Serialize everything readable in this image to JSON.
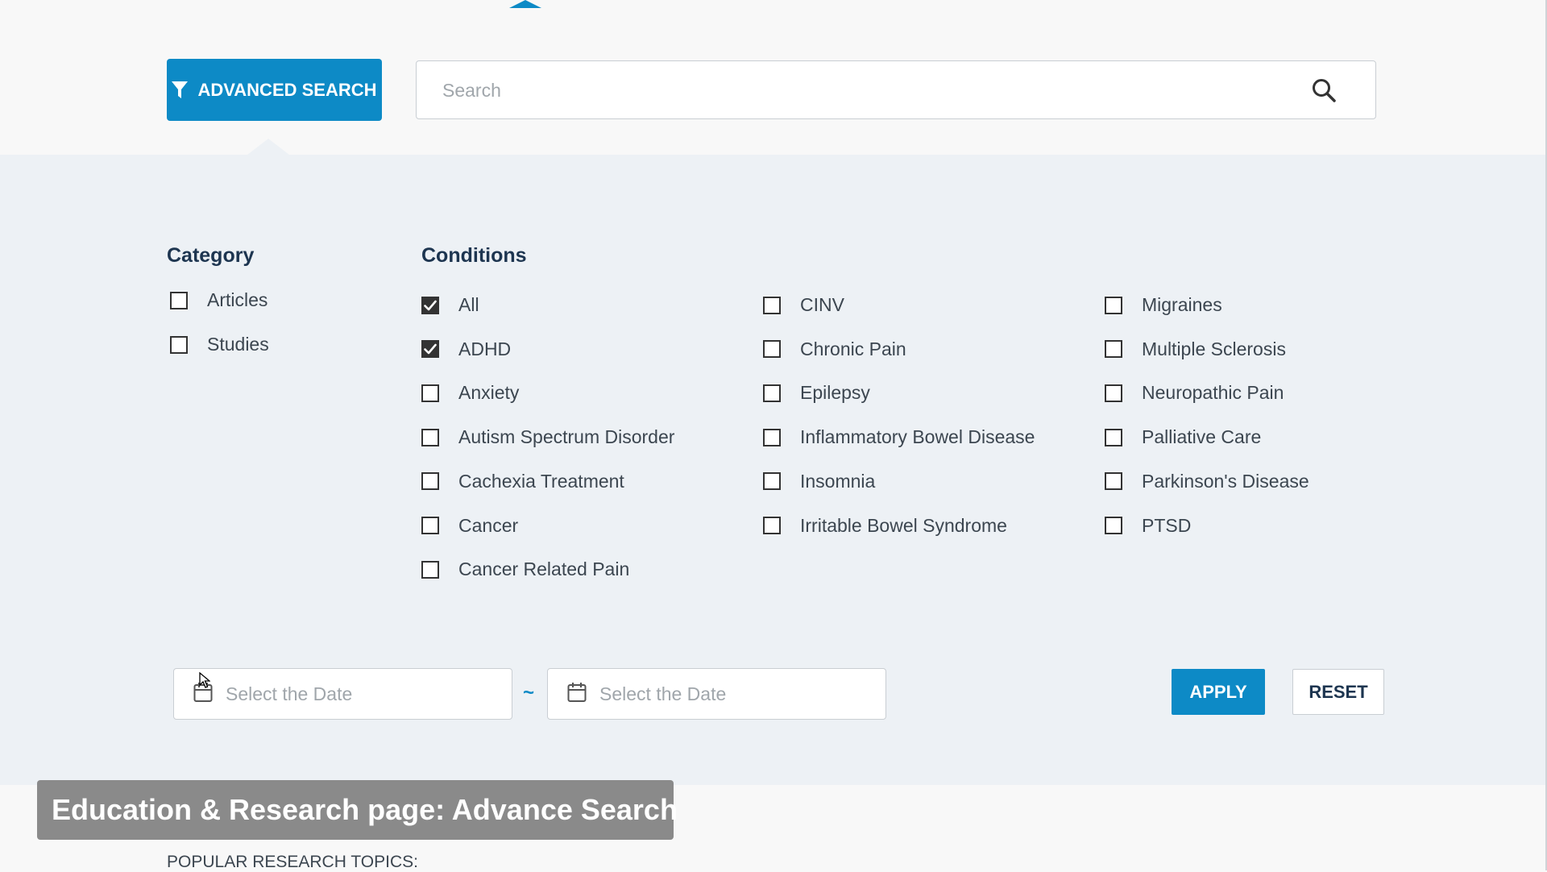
{
  "toolbar": {
    "advanced_search_label": "ADVANCED SEARCH",
    "search_placeholder": "Search"
  },
  "category": {
    "title": "Category",
    "items": [
      {
        "label": "Articles",
        "checked": false
      },
      {
        "label": "Studies",
        "checked": false
      }
    ]
  },
  "conditions": {
    "title": "Conditions",
    "columns": [
      [
        {
          "label": "All",
          "checked": true
        },
        {
          "label": "ADHD",
          "checked": true
        },
        {
          "label": "Anxiety",
          "checked": false
        },
        {
          "label": "Autism Spectrum Disorder",
          "checked": false
        },
        {
          "label": "Cachexia Treatment",
          "checked": false
        },
        {
          "label": "Cancer",
          "checked": false
        },
        {
          "label": "Cancer Related Pain",
          "checked": false
        }
      ],
      [
        {
          "label": "CINV",
          "checked": false
        },
        {
          "label": "Chronic Pain",
          "checked": false
        },
        {
          "label": "Epilepsy",
          "checked": false
        },
        {
          "label": "Inflammatory Bowel Disease",
          "checked": false
        },
        {
          "label": "Insomnia",
          "checked": false
        },
        {
          "label": "Irritable Bowel Syndrome",
          "checked": false
        }
      ],
      [
        {
          "label": "Migraines",
          "checked": false
        },
        {
          "label": "Multiple Sclerosis",
          "checked": false
        },
        {
          "label": "Neuropathic Pain",
          "checked": false
        },
        {
          "label": "Palliative Care",
          "checked": false
        },
        {
          "label": "Parkinson's Disease",
          "checked": false
        },
        {
          "label": "PTSD",
          "checked": false
        }
      ]
    ]
  },
  "date_range": {
    "from_placeholder": "Select the Date",
    "separator": "~",
    "to_placeholder": "Select the Date"
  },
  "actions": {
    "apply_label": "APPLY",
    "reset_label": "RESET"
  },
  "caption": "Education & Research page: Advance Search",
  "popular_topics_label": "POPULAR RESEARCH TOPICS:",
  "colors": {
    "accent": "#0d8ac6",
    "panel_bg": "#edf1f5",
    "heading": "#1d3550"
  }
}
